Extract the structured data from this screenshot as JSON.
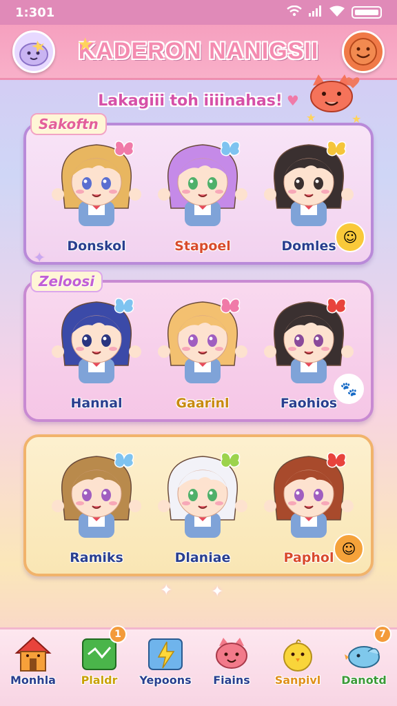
{
  "status_bar": {
    "time": "1:301"
  },
  "header": {
    "title": "KADERON NANIGSII"
  },
  "subtitle": "Lakagiii toh iiiinahas!",
  "panels": [
    {
      "tag": "Sakoftn",
      "characters": [
        {
          "name": "Donskol",
          "hair": "#e8b660",
          "eyes": "#5a6fd0",
          "bow": "#f07aa8"
        },
        {
          "name": "Stapoel",
          "hair": "#c58ae8",
          "eyes": "#4fb06a",
          "bow": "#7ec3f0"
        },
        {
          "name": "Domles",
          "hair": "#3a3030",
          "eyes": "#3a3030",
          "bow": "#f5c53a"
        }
      ]
    },
    {
      "tag": "Zeloosi",
      "characters": [
        {
          "name": "Hannal",
          "hair": "#3b4aa8",
          "eyes": "#2a3580",
          "bow": "#7ec3f0"
        },
        {
          "name": "Gaarinl",
          "hair": "#f3c070",
          "eyes": "#a05ec0",
          "bow": "#f07aa8"
        },
        {
          "name": "Faohios",
          "hair": "#3a3030",
          "eyes": "#8a4a9a",
          "bow": "#e8433c"
        }
      ]
    },
    {
      "tag": "",
      "characters": [
        {
          "name": "Ramiks",
          "hair": "#b98a4c",
          "eyes": "#a05ec0",
          "bow": "#7ec3f0"
        },
        {
          "name": "Dlaniae",
          "hair": "#f2f2f8",
          "eyes": "#4fb06a",
          "bow": "#9cd34c"
        },
        {
          "name": "Paphol",
          "hair": "#a84a2c",
          "eyes": "#a05ec0",
          "bow": "#e8433c"
        }
      ]
    }
  ],
  "nav": [
    {
      "label": "Monhla",
      "icon": "house-icon",
      "color": "#2a3f8f",
      "badge": ""
    },
    {
      "label": "Plaldr",
      "icon": "gift-card-icon",
      "color": "#c9a108",
      "badge": "1"
    },
    {
      "label": "Yepoons",
      "icon": "lightning-card-icon",
      "color": "#2a3f8f",
      "badge": ""
    },
    {
      "label": "Fiains",
      "icon": "pet-icon",
      "color": "#2a3f8f",
      "badge": ""
    },
    {
      "label": "Sanpivl",
      "icon": "chick-icon",
      "color": "#e0901c",
      "badge": ""
    },
    {
      "label": "Danotd",
      "icon": "bird-icon",
      "color": "#3d9a3a",
      "badge": "7"
    }
  ]
}
